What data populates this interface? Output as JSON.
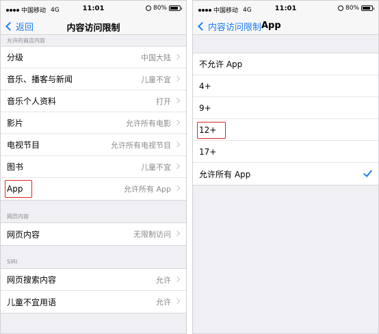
{
  "left": {
    "status": {
      "carrier": "中国移动",
      "network": "4G",
      "time": "11:01",
      "battery": "80%"
    },
    "nav": {
      "back": "返回",
      "title": "内容访问限制"
    },
    "sections": [
      {
        "header": "允许的商店内容",
        "rows": [
          {
            "label": "分级",
            "value": "中国大陆"
          },
          {
            "label": "音乐、播客与新闻",
            "value": "儿童不宜"
          },
          {
            "label": "音乐个人资料",
            "value": "打开"
          },
          {
            "label": "影片",
            "value": "允许所有电影"
          },
          {
            "label": "电视节目",
            "value": "允许所有电视节目"
          },
          {
            "label": "图书",
            "value": "儿童不宜"
          },
          {
            "label": "App",
            "value": "允许所有 App"
          }
        ]
      },
      {
        "header": "网页内容",
        "rows": [
          {
            "label": "网页内容",
            "value": "无限制访问"
          }
        ]
      },
      {
        "header": "SIRI",
        "rows": [
          {
            "label": "网页搜索内容",
            "value": "允许"
          },
          {
            "label": "儿童不宜用语",
            "value": "允许"
          }
        ]
      }
    ]
  },
  "right": {
    "status": {
      "carrier": "中国移动",
      "network": "4G",
      "time": "11:01",
      "battery": "80%"
    },
    "nav": {
      "back": "内容访问限制",
      "title": "App"
    },
    "options": [
      {
        "label": "不允许 App"
      },
      {
        "label": "4+"
      },
      {
        "label": "9+"
      },
      {
        "label": "12+"
      },
      {
        "label": "17+"
      },
      {
        "label": "允许所有 App",
        "selected": true
      }
    ]
  },
  "colors": {
    "accent": "#1a7cf5",
    "highlight": "#e02020",
    "background": "#efeff4"
  }
}
